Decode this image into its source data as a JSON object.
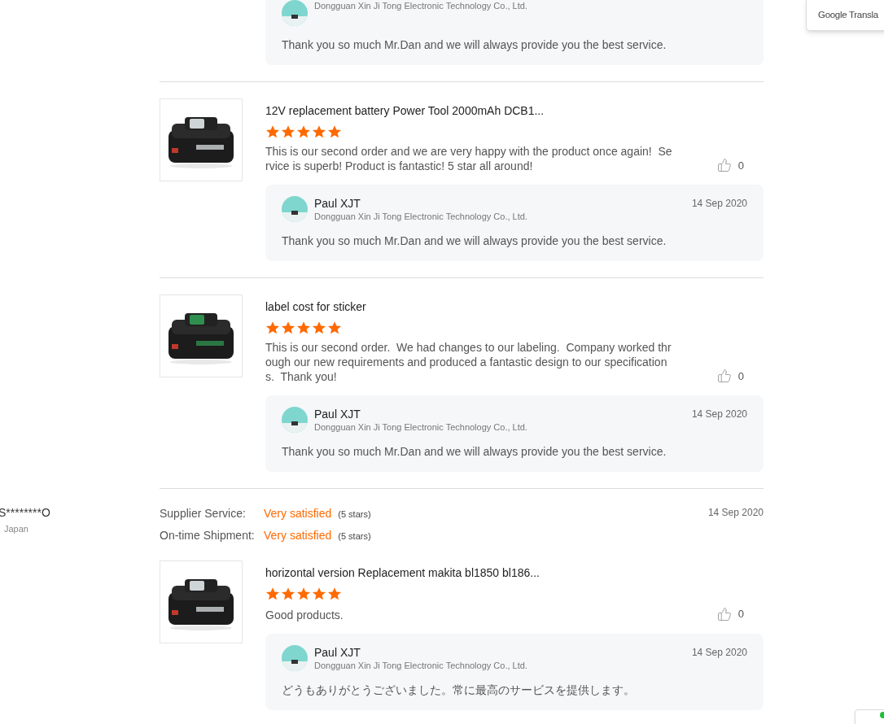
{
  "translate_widget": {
    "label": "Google Transla"
  },
  "entries": [
    {
      "kind": "reply",
      "company": "Dongguan Xin Ji Tong Electronic Technology Co., Ltd.",
      "message": "Thank you so much Mr.Dan and we will always provide you the best service."
    },
    {
      "kind": "product",
      "title": "12V replacement battery Power Tool 2000mAh DCB1...",
      "stars": 5,
      "text": "This is our second order and we are very happy with the product once again!  Service is superb! Product is fantastic! 5 star all around!",
      "likes": "0",
      "reply": {
        "name": "Paul XJT",
        "company": "Dongguan Xin Ji Tong Electronic Technology Co., Ltd.",
        "date": "14 Sep 2020",
        "message": "Thank you so much Mr.Dan and we will always provide you the best service."
      }
    },
    {
      "kind": "product",
      "title": "label cost for sticker",
      "stars": 5,
      "text": "This is our second order.  We had changes to our labeling.  Company worked through our new requirements and produced a fantastic design to our specifications.  Thank you!",
      "likes": "0",
      "reply": {
        "name": "Paul XJT",
        "company": "Dongguan Xin Ji Tong Electronic Technology Co., Ltd.",
        "date": "14 Sep 2020",
        "message": "Thank you so much Mr.Dan and we will always provide you the best service."
      }
    },
    {
      "kind": "reviewer",
      "name": "S********O",
      "country": "Japan",
      "date": "14 Sep 2020",
      "ratings": [
        {
          "label": "Supplier Service:",
          "value": "Very satisfied",
          "note": "(5 stars)"
        },
        {
          "label": "On-time Shipment:",
          "value": "Very satisfied",
          "note": "(5 stars)"
        }
      ]
    },
    {
      "kind": "product",
      "title": "horizontal version Replacement makita bl1850 bl186...",
      "stars": 5,
      "text": "Good products.",
      "likes": "0",
      "reply": {
        "name": "Paul XJT",
        "company": "Dongguan Xin Ji Tong Electronic Technology Co., Ltd.",
        "date": "14 Sep 2020",
        "message": "どうもありがとうございました。常に最高のサービスを提供します。"
      }
    }
  ]
}
